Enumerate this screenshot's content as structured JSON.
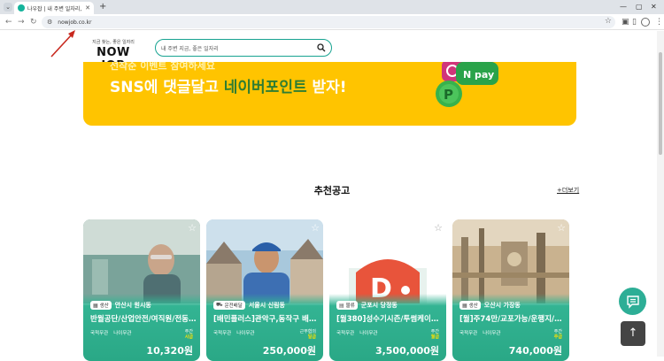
{
  "browser": {
    "tab_title": "나우잡 | 내 주변 일자리, 맞춤 일...",
    "url": "nowjob.co.kr"
  },
  "header": {
    "logo_tagline": "지금 찾는, 좋은 일자리",
    "logo_text": "NOW JOB",
    "search_placeholder": "내 주변 지금, 좋은 일자리"
  },
  "banner": {
    "top_text": "선착순 이벤트 참여하세요",
    "line_prefix": "SNS에 댓글달고 ",
    "line_highlight": "네이버포인트",
    "line_suffix": " 받자!",
    "badge": "N pay"
  },
  "section": {
    "title": "추천공고",
    "more": "+더보기"
  },
  "cards": [
    {
      "category": "생산",
      "location": "안산시 원시동",
      "title": "반월공단/산업안전/여직원/전동...",
      "tag1": "국적무관",
      "tag2": "나이무관",
      "pay_type_label": "주간",
      "pay_type": "시급",
      "pay": "10,320원"
    },
    {
      "category": "운전배달",
      "location": "서울시 신림동",
      "title": "[배민플러스]관악구,동작구 배민...",
      "tag1": "국적무관",
      "tag2": "나이무관",
      "pay_type_label": "근무협의",
      "pay_type": "일급",
      "pay": "250,000원"
    },
    {
      "category": "물류",
      "location": "군포시 당정동",
      "title": "[월380]성수기시즌/투썸케이크 ...",
      "tag1": "국적무관",
      "tag2": "나이무관",
      "pay_type_label": "주간",
      "pay_type": "월급",
      "pay": "3,500,000원"
    },
    {
      "category": "생산",
      "location": "오산시 가장동",
      "title": "[월]주74만/교포가능/운행지/단...",
      "tag1": "국적무관",
      "tag2": "나이무관",
      "pay_type_label": "주간",
      "pay_type": "주급",
      "pay": "740,000원"
    }
  ],
  "colors": {
    "brand": "#17a391",
    "banner": "#ffc400",
    "card_overlay": "#2aa886"
  }
}
